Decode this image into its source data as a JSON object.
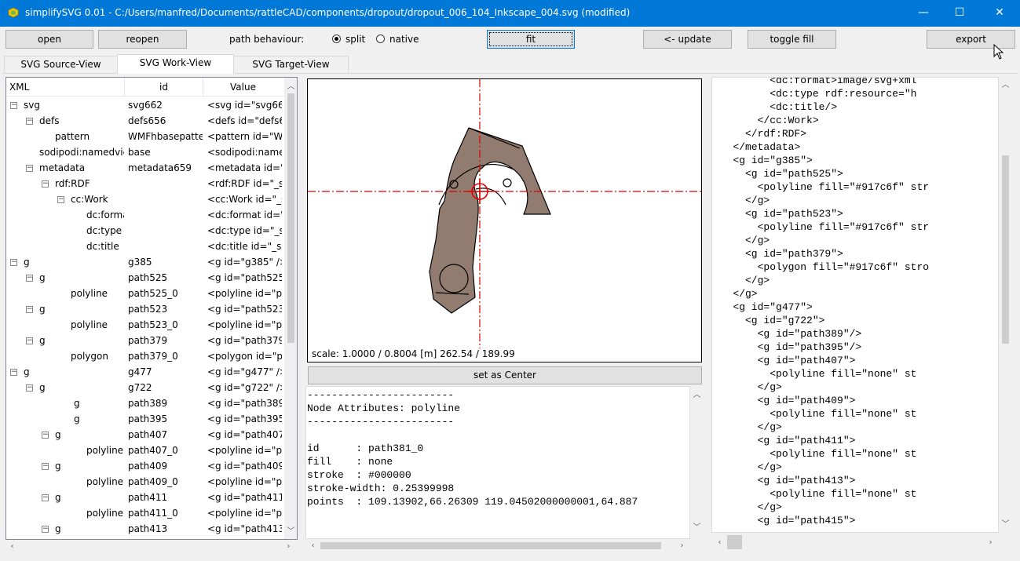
{
  "window": {
    "title": "simplifySVG 0.01 - C:/Users/manfred/Documents/rattleCAD/components/dropout/dropout_006_104_Inkscape_004.svg (modified)",
    "minimize": "—",
    "maximize": "☐",
    "close": "✕"
  },
  "toolbar": {
    "open": "open",
    "reopen": "reopen",
    "path_behaviour_label": "path behaviour:",
    "split": "split",
    "native": "native",
    "fit": "fit",
    "update": "<- update",
    "toggle_fill": "toggle fill",
    "export": "export"
  },
  "tabs": [
    "SVG Source-View",
    "SVG Work-View",
    "SVG Target-View"
  ],
  "tree": {
    "headers": [
      "XML",
      "id",
      "Value"
    ],
    "rows": [
      {
        "level": 0,
        "exp": "-",
        "name": "svg",
        "id": "svg662",
        "value": "<svg id=\"svg662"
      },
      {
        "level": 1,
        "exp": "-",
        "name": "defs",
        "id": "defs656",
        "value": "<defs id=\"defs6"
      },
      {
        "level": 2,
        "exp": "",
        "name": "pattern",
        "id": "WMFhbasepatte",
        "value": "<pattern id=\"W"
      },
      {
        "level": 1,
        "exp": "",
        "name": "sodipodi:namedvie",
        "id": "base",
        "value": "<sodipodi:name"
      },
      {
        "level": 1,
        "exp": "-",
        "name": "metadata",
        "id": "metadata659",
        "value": "<metadata id=\""
      },
      {
        "level": 2,
        "exp": "-",
        "name": "rdf:RDF",
        "id": "",
        "value": "<rdf:RDF id=\"_s"
      },
      {
        "level": 3,
        "exp": "-",
        "name": "cc:Work",
        "id": "",
        "value": "<cc:Work id=\"_s"
      },
      {
        "level": 4,
        "exp": "",
        "name": "dc:forma",
        "id": "",
        "value": "<dc:format id=\"_"
      },
      {
        "level": 4,
        "exp": "",
        "name": "dc:type",
        "id": "",
        "value": "<dc:type id=\"_s"
      },
      {
        "level": 4,
        "exp": "",
        "name": "dc:title",
        "id": "",
        "value": "<dc:title id=\"_se"
      },
      {
        "level": 0,
        "exp": "-",
        "name": "g",
        "id": "g385",
        "value": "<g id=\"g385\" />"
      },
      {
        "level": 1,
        "exp": "-",
        "name": "g",
        "id": "path525",
        "value": "<g id=\"path525"
      },
      {
        "level": 3,
        "exp": "",
        "name": "polyline",
        "id": "path525_0",
        "value": "<polyline id=\"pa"
      },
      {
        "level": 1,
        "exp": "-",
        "name": "g",
        "id": "path523",
        "value": "<g id=\"path523"
      },
      {
        "level": 3,
        "exp": "",
        "name": "polyline",
        "id": "path523_0",
        "value": "<polyline id=\"pa"
      },
      {
        "level": 1,
        "exp": "-",
        "name": "g",
        "id": "path379",
        "value": "<g id=\"path379"
      },
      {
        "level": 3,
        "exp": "",
        "name": "polygon",
        "id": "path379_0",
        "value": "<polygon id=\"p"
      },
      {
        "level": 0,
        "exp": "-",
        "name": "g",
        "id": "g477",
        "value": "<g id=\"g477\" />"
      },
      {
        "level": 1,
        "exp": "-",
        "name": "g",
        "id": "g722",
        "value": "<g id=\"g722\" />"
      },
      {
        "level": 3.2,
        "exp": "",
        "name": "g",
        "id": "path389",
        "value": "<g id=\"path389"
      },
      {
        "level": 3.2,
        "exp": "",
        "name": "g",
        "id": "path395",
        "value": "<g id=\"path395"
      },
      {
        "level": 2,
        "exp": "-",
        "name": "g",
        "id": "path407",
        "value": "<g id=\"path407"
      },
      {
        "level": 4,
        "exp": "",
        "name": "polyline",
        "id": "path407_0",
        "value": "<polyline id=\"pa"
      },
      {
        "level": 2,
        "exp": "-",
        "name": "g",
        "id": "path409",
        "value": "<g id=\"path409"
      },
      {
        "level": 4,
        "exp": "",
        "name": "polyline",
        "id": "path409_0",
        "value": "<polyline id=\"pa"
      },
      {
        "level": 2,
        "exp": "-",
        "name": "g",
        "id": "path411",
        "value": "<g id=\"path411"
      },
      {
        "level": 4,
        "exp": "",
        "name": "polyline",
        "id": "path411_0",
        "value": "<polyline id=\"pa"
      },
      {
        "level": 2,
        "exp": "-",
        "name": "g",
        "id": "path413",
        "value": "<g id=\"path413"
      }
    ]
  },
  "canvas": {
    "status": "scale: 1.0000 / 0.8004  [m]  262.54 / 189.99",
    "set_center": "set as Center",
    "part_fill": "#917c6f"
  },
  "attributes": {
    "lines": [
      "------------------------",
      "Node Attributes: polyline",
      "------------------------",
      "",
      "id      : path381_0",
      "fill    : none",
      "stroke  : #000000",
      "stroke-width: 0.25399998",
      "points  : 109.13902,66.26309 119.04502000000001,64.887"
    ]
  },
  "source": {
    "lines": [
      "         <dc:format>image/svg+xml",
      "         <dc:type rdf:resource=\"h",
      "         <dc:title/>",
      "       </cc:Work>",
      "     </rdf:RDF>",
      "   </metadata>",
      "   <g id=\"g385\">",
      "     <g id=\"path525\">",
      "       <polyline fill=\"#917c6f\" str",
      "     </g>",
      "     <g id=\"path523\">",
      "       <polyline fill=\"#917c6f\" str",
      "     </g>",
      "     <g id=\"path379\">",
      "       <polygon fill=\"#917c6f\" stro",
      "     </g>",
      "   </g>",
      "   <g id=\"g477\">",
      "     <g id=\"g722\">",
      "       <g id=\"path389\"/>",
      "       <g id=\"path395\"/>",
      "       <g id=\"path407\">",
      "         <polyline fill=\"none\" st",
      "       </g>",
      "       <g id=\"path409\">",
      "         <polyline fill=\"none\" st",
      "       </g>",
      "       <g id=\"path411\">",
      "         <polyline fill=\"none\" st",
      "       </g>",
      "       <g id=\"path413\">",
      "         <polyline fill=\"none\" st",
      "       </g>",
      "       <g id=\"path415\">"
    ]
  }
}
